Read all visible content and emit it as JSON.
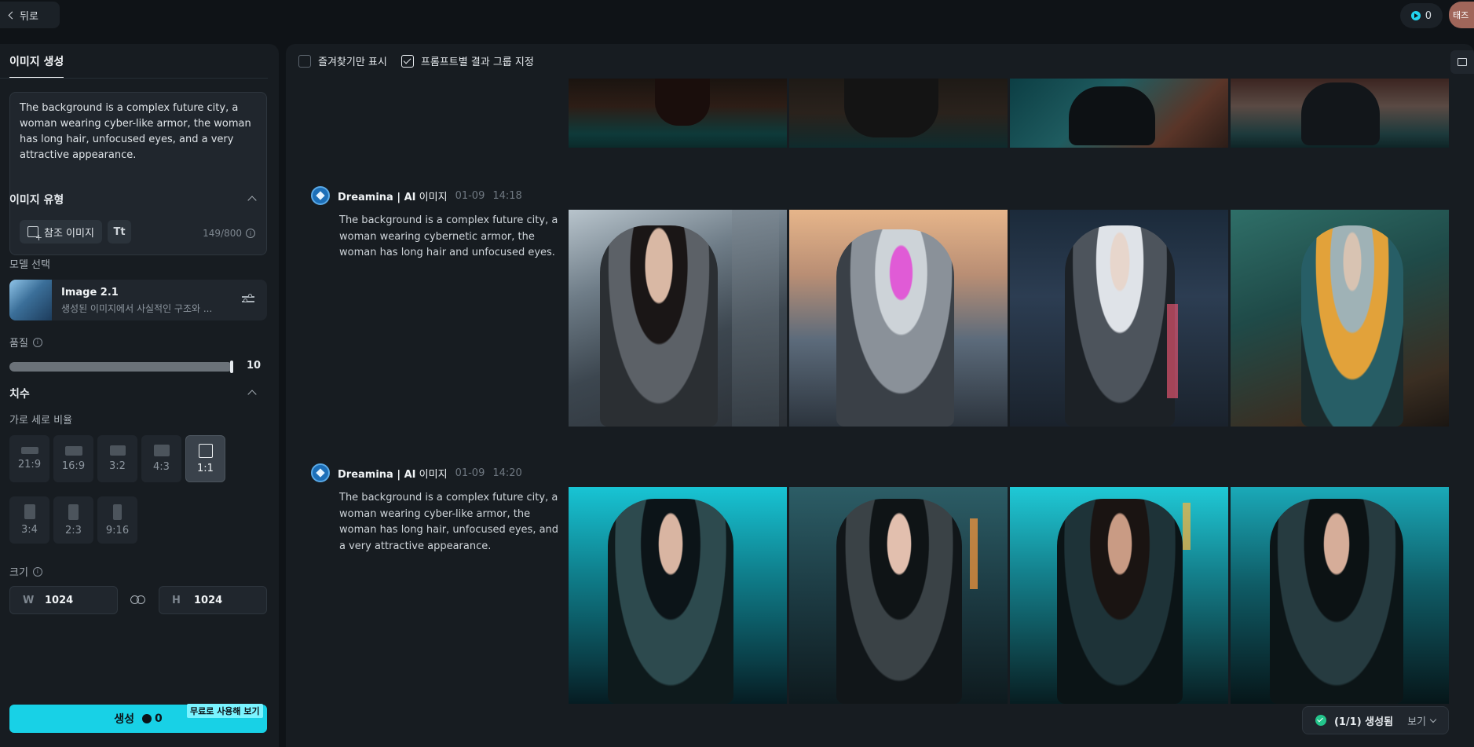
{
  "topbar": {
    "back_label": "뒤로",
    "credits": "0",
    "avatar_text": "태즈"
  },
  "left": {
    "tab_label": "이미지 생성",
    "prompt_text": "The background is a complex future city, a woman wearing cyber-like armor, the woman has long hair, unfocused eyes, and a very attractive appearance.",
    "ref_image_label": "참조 이미지",
    "text_tool_glyph": "Tt",
    "char_count": "149/800",
    "image_type_title": "이미지 유형",
    "model_select_label": "모델 선택",
    "model_name": "Image 2.1",
    "model_desc": "생성된 이미지에서 사실적인 구조와 ...",
    "quality_label": "품질",
    "quality_value": "10",
    "quality_fraction": 1.0,
    "dimension_title": "치수",
    "aspect_label": "가로 세로 비율",
    "ratios": [
      "21:9",
      "16:9",
      "3:2",
      "4:3",
      "1:1",
      "3:4",
      "2:3",
      "9:16"
    ],
    "selected_ratio": "1:1",
    "size_label": "크기",
    "width_label": "W",
    "width_value": "1024",
    "height_label": "H",
    "height_value": "1024",
    "generate_label": "생성",
    "generate_cost": "0",
    "free_badge": "무료로 사용해 보기"
  },
  "main": {
    "favorites_only_label": "즐겨찾기만 표시",
    "favorites_only_checked": false,
    "group_by_prompt_label": "프롬프트별 결과 그룹 지정",
    "group_by_prompt_checked": true,
    "generations": [
      {
        "brand": "Dreamina | AI",
        "kind": "이미지",
        "date": "01-09",
        "time": "14:18",
        "prompt": "The background is a complex future city, a woman wearing cybernetic armor, the woman has long hair and unfocused eyes."
      },
      {
        "brand": "Dreamina | AI",
        "kind": "이미지",
        "date": "01-09",
        "time": "14:20",
        "prompt": "The background is a complex future city, a woman wearing cyber-like armor, the woman has long hair, unfocused eyes, and a very attractive appearance."
      }
    ],
    "status_text": "(1/1) 생성됨",
    "view_label": "보기"
  },
  "colors": {
    "accent": "#18d1e6",
    "success": "#23c48b",
    "panel": "#171c21",
    "background": "#0f1317"
  }
}
